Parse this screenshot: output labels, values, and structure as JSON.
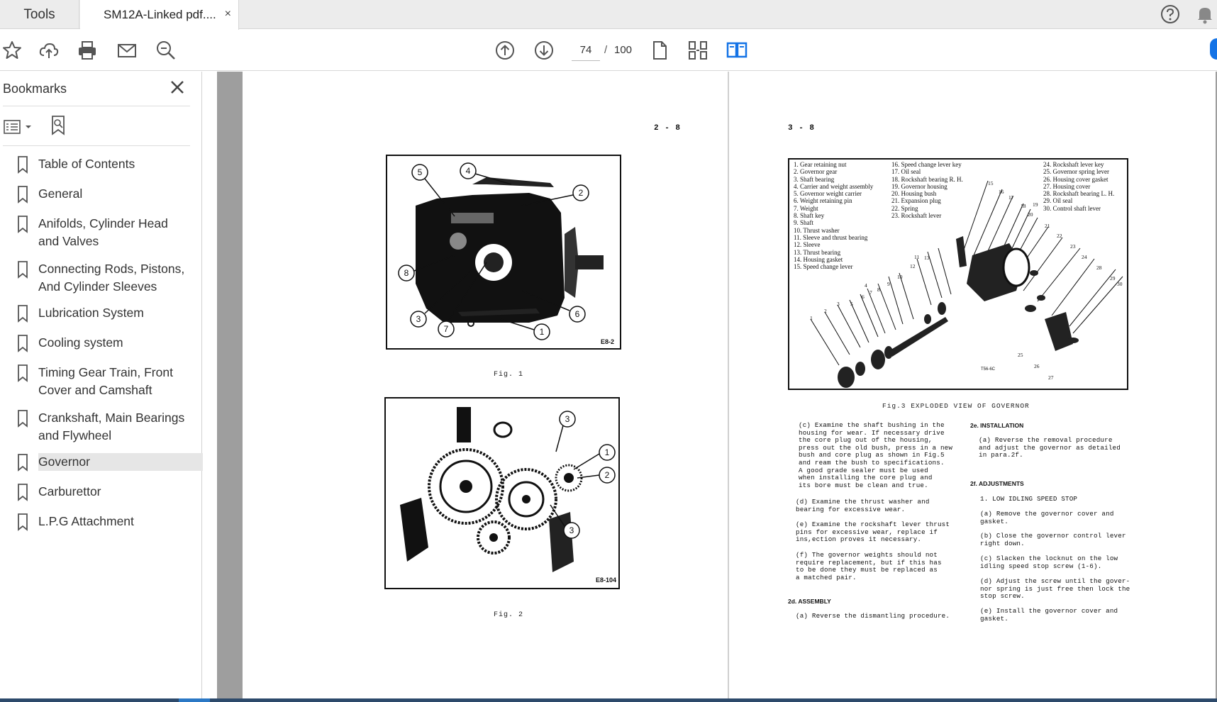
{
  "tabs": {
    "tools_label": "Tools",
    "doc_label": "SM12A-Linked pdf....",
    "close_glyph": "×"
  },
  "toolbar": {
    "icons": [
      "star-icon",
      "upload-cloud-icon",
      "print-icon",
      "email-icon",
      "search-zoom-icon",
      "page-up-icon",
      "page-down-icon",
      "single-page-icon",
      "page-thumbnails-icon",
      "two-page-view-icon"
    ],
    "page_current": "74",
    "page_sep": "/",
    "page_total": "100",
    "accent_color": "#1473e6"
  },
  "sidebar": {
    "title": "Bookmarks",
    "items": [
      {
        "label": "Table of Contents"
      },
      {
        "label": "General"
      },
      {
        "label": "Anifolds, Cylinder Head and Valves"
      },
      {
        "label": "Connecting Rods, Pistons, And Cylinder Sleeves"
      },
      {
        "label": "Lubrication System"
      },
      {
        "label": "Cooling system"
      },
      {
        "label": "Timing Gear Train, Front Cover and Camshaft"
      },
      {
        "label": "Crankshaft, Main Bearings and Flywheel"
      },
      {
        "label": "Governor",
        "selected": true
      },
      {
        "label": "Carburettor"
      },
      {
        "label": "L.P.G Attachment"
      }
    ]
  },
  "left_page": {
    "page_number": "2 - 8",
    "fig1": {
      "code": "E8-2",
      "caption": "Fig. 1",
      "callouts": [
        "5",
        "4",
        "2",
        "8",
        "3",
        "7",
        "6",
        "1"
      ]
    },
    "fig2": {
      "code": "E8-104",
      "caption": "Fig. 2",
      "callouts": [
        "3",
        "1",
        "2",
        "3"
      ]
    }
  },
  "right_page": {
    "page_number": "3 - 8",
    "fig3": {
      "caption": "Fig.3  EXPLODED VIEW OF GOVERNOR",
      "code": "T56-6C",
      "parts_col1": [
        "1. Gear retaining nut",
        "2. Governor gear",
        "3. Shaft bearing",
        "4. Carrier and weight assembly",
        "5. Governor weight carrier",
        "6. Weight retaining pin",
        "7. Weight",
        "8. Shaft key",
        "9. Shaft",
        "10. Thrust washer",
        "11. Sleeve and thrust bearing",
        "12. Sleeve",
        "13. Thrust bearing",
        "14. Housing gasket",
        "15. Speed change lever"
      ],
      "parts_col2": [
        "16. Speed change lever key",
        "17. Oil seal",
        "18. Rockshaft bearing R. H.",
        "19. Governor housing",
        "20. Housing bush",
        "21. Expansion plug",
        "22. Spring",
        "23. Rockshaft lever"
      ],
      "parts_col3": [
        "24. Rockshaft lever key",
        "25. Governor spring lever",
        "26. Housing cover gasket",
        "27. Housing cover",
        "28. Rockshaft bearing L. H.",
        "29. Oil seal",
        "30. Control shaft lever"
      ],
      "diagram_numbers": [
        "15",
        "16",
        "17",
        "18",
        "19",
        "20",
        "21",
        "22",
        "23",
        "24",
        "28",
        "29",
        "30",
        "11",
        "12",
        "13",
        "10",
        "9",
        "8",
        "7",
        "6",
        "5",
        "4",
        "3",
        "2",
        "1",
        "25",
        "26",
        "27"
      ]
    },
    "text_left": {
      "para_c": "(c) Examine the shaft bushing in the\nhousing for wear. If necessary drive\nthe core plug out of the housing,\npress out the old bush, press in a new\nbush and core plug as shown in Fig.5\nand ream the bush to specifications.\nA good grade sealer must be used\nwhen installing the core plug and\nits bore must be clean and true.",
      "para_d": "(d) Examine the thrust washer and\nbearing for excessive wear.",
      "para_e": "(e) Examine the rockshaft lever thrust\npins for excessive wear, replace if\nins,ection proves it necessary.",
      "para_f": "(f) The governor weights should not\nrequire replacement, but if this has\nto be done they must be replaced as\na matched pair.",
      "heading_2d": "2d. ASSEMBLY",
      "para_2d_a": "(a) Reverse the dismantling procedure."
    },
    "text_right": {
      "heading_2e": "2e. INSTALLATION",
      "para_2e_a": "(a) Reverse the removal procedure\nand adjust the governor as detailed\nin para.2f.",
      "heading_2f": "2f. ADJUSTMENTS",
      "sub_1": "1. LOW IDLING SPEED STOP",
      "para_a": "(a) Remove the governor cover and\ngasket.",
      "para_b": "(b) Close the governor control lever\nright down.",
      "para_c": "(c) Slacken the locknut on the low\nidling speed stop screw (1-6).",
      "para_d": "(d) Adjust the screw until the gover-\nnor spring is just free then lock the\nstop screw.",
      "para_e": "(e) Install the governor cover and\ngasket."
    }
  }
}
